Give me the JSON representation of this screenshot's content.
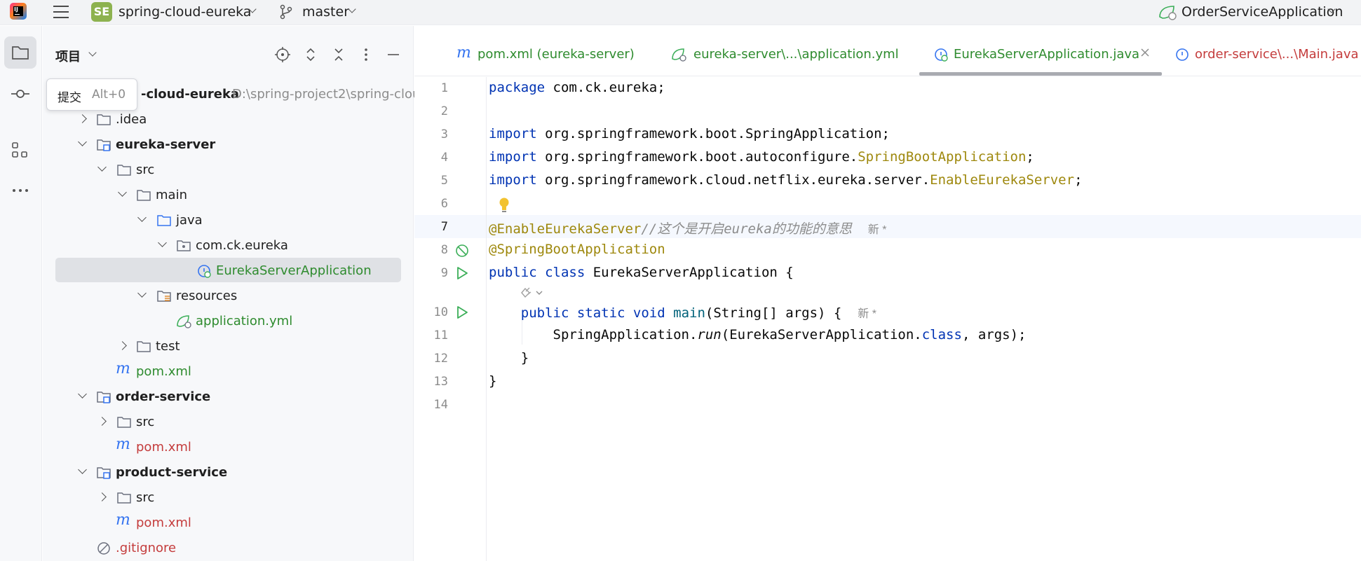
{
  "titlebar": {
    "project_badge": "SE",
    "project_name": "spring-cloud-eureka",
    "branch": "master",
    "run_config": "OrderServiceApplication"
  },
  "toolstrip": {
    "items": [
      "project-tool",
      "commit-tool",
      "structure-tool",
      "more-tools"
    ]
  },
  "tooltip": {
    "label": "提交",
    "shortcut": "Alt+0"
  },
  "project_panel": {
    "title": "项目",
    "tree": [
      {
        "label": "-cloud-eureka",
        "suffix": "D:\\spring-project2\\spring-clou",
        "bold": true
      },
      {
        "label": ".idea"
      },
      {
        "label": "eureka-server",
        "bold": true
      },
      {
        "label": "src"
      },
      {
        "label": "main"
      },
      {
        "label": "java"
      },
      {
        "label": "com.ck.eureka"
      },
      {
        "label": "EurekaServerApplication",
        "selected": true
      },
      {
        "label": "resources"
      },
      {
        "label": "application.yml"
      },
      {
        "label": "test"
      },
      {
        "label": "pom.xml"
      },
      {
        "label": "order-service",
        "bold": true
      },
      {
        "label": "src"
      },
      {
        "label": "pom.xml"
      },
      {
        "label": "product-service",
        "bold": true
      },
      {
        "label": "src"
      },
      {
        "label": "pom.xml"
      },
      {
        "label": ".gitignore"
      }
    ]
  },
  "tabs": [
    {
      "label": "pom.xml (eureka-server)"
    },
    {
      "label": "eureka-server\\...\\application.yml"
    },
    {
      "label": "EurekaServerApplication.java",
      "active": true
    },
    {
      "label": "order-service\\...\\Main.java"
    }
  ],
  "editor": {
    "line_numbers": [
      "1",
      "2",
      "3",
      "4",
      "5",
      "6",
      "7",
      "8",
      "9",
      "10",
      "11",
      "12",
      "13",
      "14"
    ],
    "tokens": {
      "l1_kw": "package",
      "l1_rest": " com.ck.eureka;",
      "l3_kw": "import",
      "l3_rest": " org.springframework.boot.SpringApplication;",
      "l4_kw": "import",
      "l4_rest": " org.springframework.boot.autoconfigure.",
      "l4_ann": "SpringBootApplication",
      "l4_end": ";",
      "l5_kw": "import",
      "l5_rest": " org.springframework.cloud.netflix.eureka.server.",
      "l5_ann": "EnableEurekaServer",
      "l5_end": ";",
      "l7_ann": "@EnableEurekaServer",
      "l7_cm": "//这个是开启eureka的功能的意思",
      "l7_hint": "新 *",
      "l8_ann": "@SpringBootApplication",
      "l9_kw": "public class",
      "l9_rest": " EurekaServerApplication {",
      "l10_kw": "public static void",
      "l10_fn": "main",
      "l10_rest": "(String[] args) {",
      "l10_hint": "新 *",
      "l11_a": "SpringApplication.",
      "l11_run": "run",
      "l11_b": "(EurekaServerApplication.",
      "l11_kw": "class",
      "l11_c": ", args);",
      "l12": "}",
      "l13": "}"
    }
  },
  "colors": {
    "keyword": "#0033b3",
    "annotation": "#9e880d",
    "comment": "#8c8c8c",
    "run_gutter": "#3bae58",
    "selection": "#dfe1e5",
    "vcs_modified_name": "#c43c3c",
    "vcs_added_name": "#2e8b2e",
    "link_blue": "#3574f0"
  }
}
